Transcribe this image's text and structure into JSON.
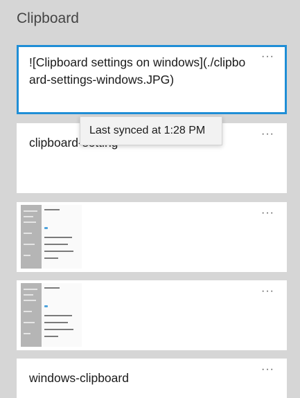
{
  "header": {
    "title": "Clipboard"
  },
  "items": [
    {
      "type": "text",
      "text": "![Clipboard settings on windows](./clipboard-settings-windows.JPG)",
      "selected": true
    },
    {
      "type": "text",
      "text": "clipboard-setting"
    },
    {
      "type": "image",
      "description": "screenshot-thumbnail"
    },
    {
      "type": "image",
      "description": "screenshot-thumbnail"
    },
    {
      "type": "text",
      "text": "windows-clipboard"
    }
  ],
  "more_label": "···",
  "tooltip": {
    "text": "Last synced at 1:28 PM"
  },
  "colors": {
    "accent": "#1f8ed6",
    "background": "#d6d6d6",
    "card": "#ffffff"
  }
}
